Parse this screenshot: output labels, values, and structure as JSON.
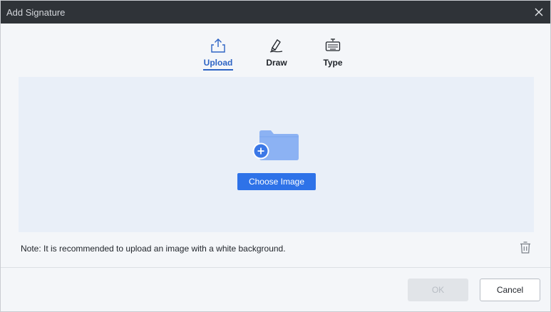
{
  "window": {
    "title": "Add Signature",
    "close_icon": "close-icon"
  },
  "tabs": [
    {
      "label": "Upload",
      "icon": "upload-icon",
      "active": true
    },
    {
      "label": "Draw",
      "icon": "pen-icon",
      "active": false
    },
    {
      "label": "Type",
      "icon": "keyboard-icon",
      "active": false
    }
  ],
  "dropzone": {
    "icon": "folder-add-icon",
    "button_label": "Choose Image"
  },
  "note": "Note: It is recommended to upload an image with a white background.",
  "delete_icon": "trash-icon",
  "footer": {
    "ok_label": "OK",
    "cancel_label": "Cancel"
  },
  "colors": {
    "accent": "#2e72e8",
    "active_tab": "#2e64c4",
    "titlebar": "#2f3338",
    "dropzone": "#e9eff8"
  }
}
